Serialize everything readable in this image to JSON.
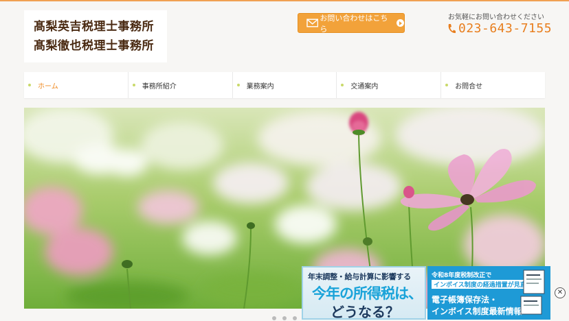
{
  "header": {
    "logo_line1": "髙梨英吉税理士事務所",
    "logo_line2": "髙梨徹也税理士事務所",
    "contact_button": "お問い合わせはこちら",
    "tel_note": "お気軽にお問い合わせください",
    "tel_number": "023-643-7155"
  },
  "nav": {
    "items": [
      {
        "label": "ホーム"
      },
      {
        "label": "事務所紹介"
      },
      {
        "label": "業務案内"
      },
      {
        "label": "交通案内"
      },
      {
        "label": "お問合せ"
      }
    ],
    "active_index": 0
  },
  "ads": {
    "left": {
      "line1": "年末調整・給与計算に影響する",
      "line2": "今年の所得税は、",
      "line3": "どうなる？"
    },
    "right": {
      "line1": "令和8年度税制改正で",
      "line2": "インボイス制度の経過措置が見直し",
      "line3": "電子帳簿保存法・",
      "line4": "インボイス制度最新情報"
    },
    "close_label": "✕"
  },
  "colors": {
    "accent": "#f2a23a",
    "tel": "#e87e1e",
    "logo_text": "#4a2a12",
    "nav_active": "#f08a22",
    "ad_blue": "#1e9ad6"
  },
  "icons": {
    "contact": "mail-icon",
    "tel": "phone-icon",
    "nav_bullet": "dot-icon",
    "close": "close-icon"
  }
}
